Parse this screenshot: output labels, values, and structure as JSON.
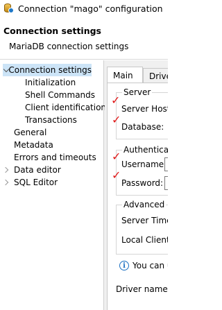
{
  "window": {
    "title": "Connection \"mago\" configuration",
    "icon": "dbeaver-database-icon"
  },
  "header": {
    "title": "Connection settings",
    "description": "MariaDB connection settings"
  },
  "tree": {
    "items": [
      {
        "label": "Connection settings",
        "expanded": true,
        "selected": true
      },
      {
        "label": "Initialization"
      },
      {
        "label": "Shell Commands"
      },
      {
        "label": "Client identification"
      },
      {
        "label": "Transactions"
      },
      {
        "label": "General"
      },
      {
        "label": "Metadata"
      },
      {
        "label": "Errors and timeouts"
      },
      {
        "label": "Data editor",
        "collapsed": true
      },
      {
        "label": "SQL Editor",
        "collapsed": true
      }
    ]
  },
  "tabs": {
    "main": "Main",
    "driver": "Drive"
  },
  "server_group": {
    "title": "Server",
    "host_label": "Server Host:",
    "database_label": "Database:"
  },
  "auth_group": {
    "title": "Authenticatio",
    "username_label": "Username:",
    "password_label": "Password:"
  },
  "advanced_group": {
    "title": "Advanced",
    "server_time_label": "Server Time",
    "local_client_label": "Local Client:"
  },
  "info": {
    "text": "You can u"
  },
  "driver_name_label": "Driver name:",
  "colors": {
    "selection": "#cce4f7",
    "annotation_mark": "#e01818",
    "info_blue": "#1a6fc2"
  }
}
